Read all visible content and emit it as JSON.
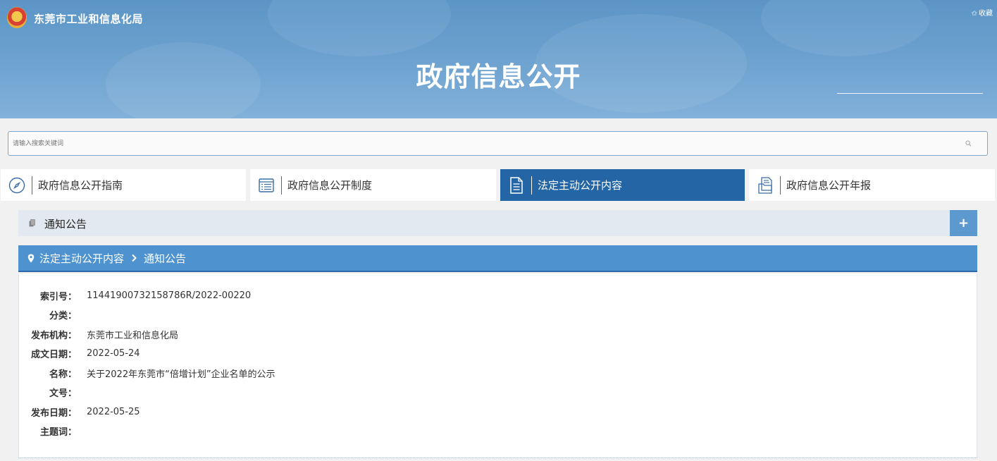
{
  "header": {
    "site_name": "东莞市工业和信息化局",
    "favorite_label": "收藏",
    "banner_title": "政府信息公开"
  },
  "search": {
    "placeholder": "请输入搜索关键词",
    "value": ""
  },
  "nav_tabs": [
    {
      "label": "政府信息公开指南",
      "icon": "compass-icon",
      "active": false
    },
    {
      "label": "政府信息公开制度",
      "icon": "list-icon",
      "active": false
    },
    {
      "label": "法定主动公开内容",
      "icon": "document-icon",
      "active": true
    },
    {
      "label": "政府信息公开年报",
      "icon": "report-icon",
      "active": false
    }
  ],
  "category": {
    "label": "通知公告",
    "expand_symbol": "+"
  },
  "breadcrumb": {
    "items": [
      "法定主动公开内容",
      "通知公告"
    ]
  },
  "info": [
    {
      "key": "索引号：",
      "value": "11441900732158786R/2022-00220"
    },
    {
      "key": "分类：",
      "value": ""
    },
    {
      "key": "发布机构：",
      "value": "东莞市工业和信息化局"
    },
    {
      "key": "成文日期：",
      "value": "2022-05-24"
    },
    {
      "key": "名称：",
      "value": "关于2022年东莞市“倍增计划”企业名单的公示"
    },
    {
      "key": "文号：",
      "value": ""
    },
    {
      "key": "发布日期：",
      "value": "2022-05-25"
    },
    {
      "key": "主题词：",
      "value": ""
    }
  ],
  "colors": {
    "banner": "#6fa3d0",
    "active_tab": "#2466a5",
    "breadcrumb": "#4e93cf",
    "category_bar": "#e2e9f0",
    "expand_button": "#5b99cf"
  }
}
